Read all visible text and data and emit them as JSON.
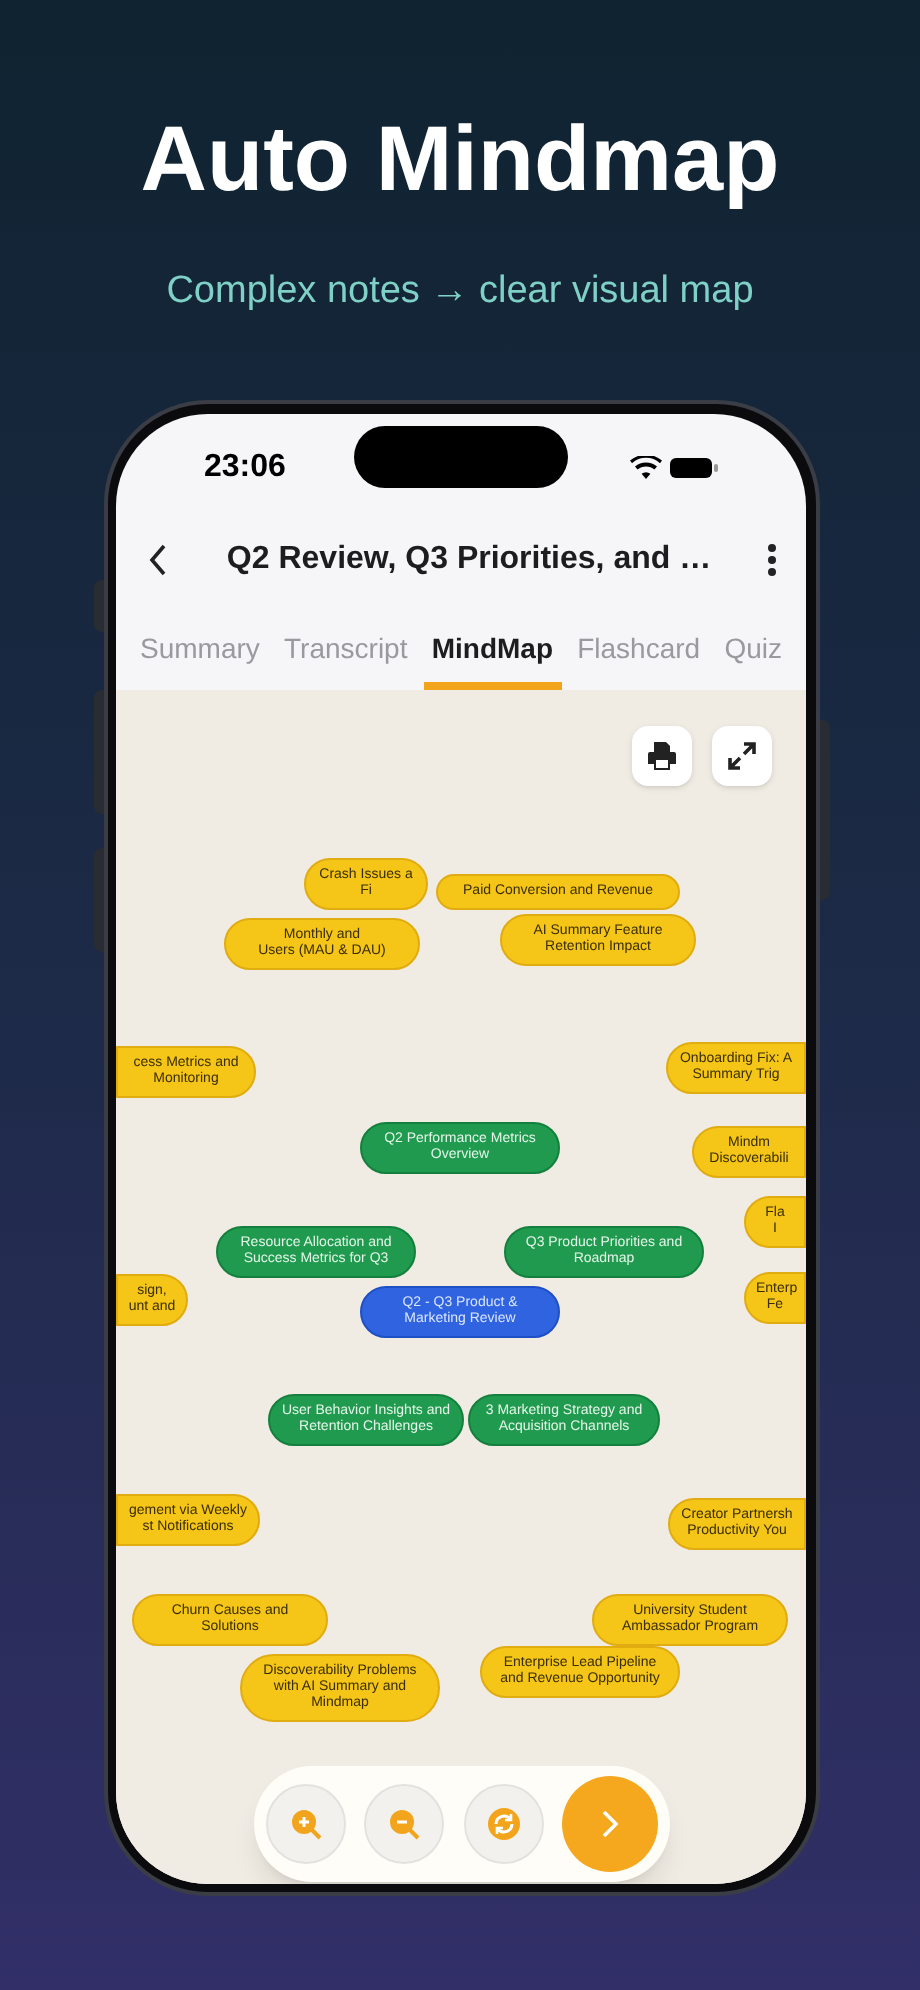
{
  "title": "Auto Mindmap",
  "subtitle": "Complex notes → clear visual map",
  "status_bar": {
    "time": "23:06"
  },
  "header": {
    "title": "Q2 Review, Q3 Priorities, and …"
  },
  "tabs": [
    {
      "label": "Summary",
      "selected": false
    },
    {
      "label": "Transcript",
      "selected": false
    },
    {
      "label": "MindMap",
      "selected": true
    },
    {
      "label": "Flashcard",
      "selected": false
    },
    {
      "label": "Quiz",
      "selected": false
    }
  ],
  "mindmap": {
    "root": {
      "text": "Q2 - Q3 Product & Marketing Review",
      "children": [
        {
          "text": "Q2 Performance Metrics Overview",
          "children": [
            {
              "text": "Crash Issues a\nFi"
            },
            {
              "text": "Paid Conversion and Revenue"
            },
            {
              "text": "Monthly and\nUsers (MAU & DAU)"
            },
            {
              "text": "AI Summary Feature Retention Impact"
            }
          ]
        },
        {
          "text": "Resource Allocation and Success Metrics for Q3",
          "children": [
            {
              "text": "cess Metrics and\nMonitoring"
            },
            {
              "text": "sign,\nunt and"
            }
          ]
        },
        {
          "text": "Q3 Product Priorities and Roadmap",
          "children": [
            {
              "text": "Onboarding Fix: A\nSummary Trig"
            },
            {
              "text": "Mindm\nDiscoverabili"
            },
            {
              "text": "Fla\nI"
            },
            {
              "text": "Enterp\nFe"
            }
          ]
        },
        {
          "text": "User Behavior Insights and Retention Challenges",
          "children": [
            {
              "text": "gement via Weekly\nst Notifications"
            },
            {
              "text": "Churn Causes and Solutions"
            },
            {
              "text": "Discoverability Problems with AI Summary and Mindmap"
            }
          ]
        },
        {
          "text": "3 Marketing Strategy and Acquisition Channels",
          "children": [
            {
              "text": "Creator Partnersh\nProductivity You"
            },
            {
              "text": "University Student Ambassador Program"
            },
            {
              "text": "Enterprise Lead Pipeline and Revenue Opportunity"
            }
          ]
        }
      ]
    }
  }
}
